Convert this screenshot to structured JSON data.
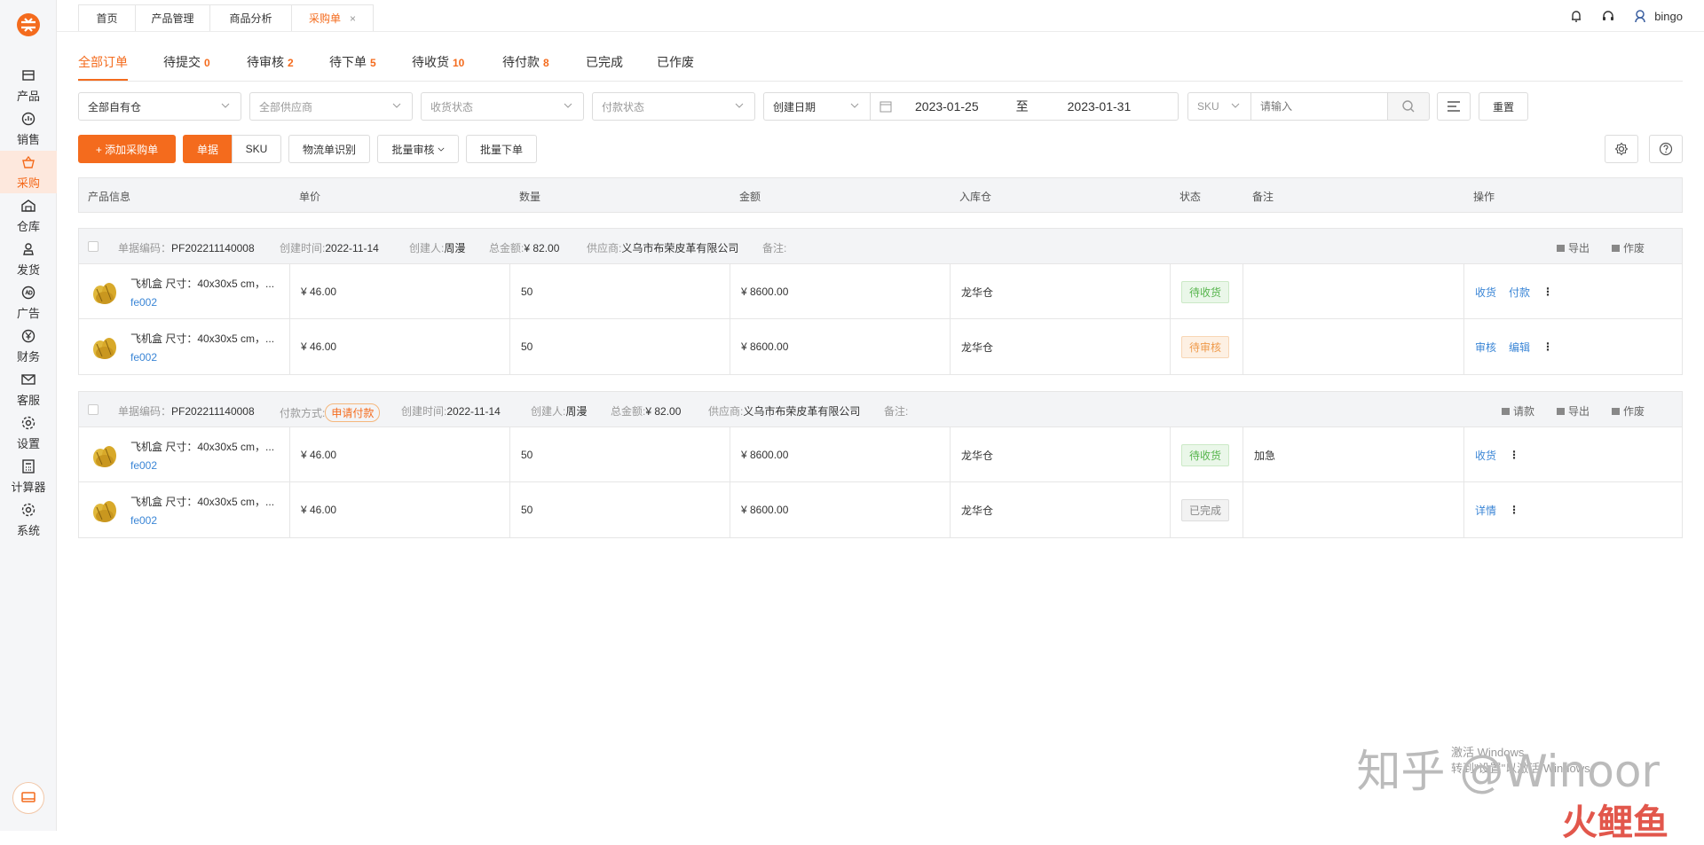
{
  "sidebar": {
    "items": [
      {
        "label": "产品",
        "icon": "box-icon"
      },
      {
        "label": "销售",
        "icon": "chart-icon"
      },
      {
        "label": "采购",
        "icon": "basket-icon",
        "active": true
      },
      {
        "label": "仓库",
        "icon": "warehouse-icon"
      },
      {
        "label": "发货",
        "icon": "truck-icon"
      },
      {
        "label": "广告",
        "icon": "ad-icon"
      },
      {
        "label": "财务",
        "icon": "yen-icon"
      },
      {
        "label": "客服",
        "icon": "mail-icon"
      },
      {
        "label": "设置",
        "icon": "gear-icon"
      },
      {
        "label": "计算器",
        "icon": "calculator-icon"
      },
      {
        "label": "系统",
        "icon": "gear-icon"
      }
    ]
  },
  "tabs": [
    {
      "label": "首页"
    },
    {
      "label": "产品管理"
    },
    {
      "label": "商品分析"
    },
    {
      "label": "采购单",
      "close": "×"
    }
  ],
  "user": {
    "name": "bingo"
  },
  "status_tabs": [
    {
      "label": "全部订单",
      "count": ""
    },
    {
      "label": "待提交",
      "count": "0"
    },
    {
      "label": "待审核",
      "count": "2"
    },
    {
      "label": "待下单",
      "count": "5"
    },
    {
      "label": "待收货",
      "count": "10"
    },
    {
      "label": "待付款",
      "count": "8"
    },
    {
      "label": "已完成",
      "count": ""
    },
    {
      "label": "已作废",
      "count": ""
    }
  ],
  "filters": {
    "warehouse": "全部自有仓",
    "supplier": "全部供应商",
    "receive_status": "收货状态",
    "pay_status": "付款状态",
    "date_type": "创建日期",
    "date_from": "2023-01-25",
    "date_sep": "至",
    "date_to": "2023-01-31",
    "search_type": "SKU",
    "search_placeholder": "请输入",
    "reset": "重置"
  },
  "toolbar": {
    "add": "+ 添加采购单",
    "view_order": "单据",
    "view_sku": "SKU",
    "logistics": "物流单识别",
    "batch_review": "批量审核",
    "batch_order": "批量下单"
  },
  "columns": [
    "产品信息",
    "单价",
    "数量",
    "金额",
    "入库仓",
    "状态",
    "备注",
    "操作"
  ],
  "orders": [
    {
      "code_label": "单据编码：",
      "code": "PF202211140008",
      "pay_label": "",
      "pay_value": "",
      "created_label": "创建时间:",
      "created": "2022-11-14",
      "creator_label": "创建人:",
      "creator": "周漫",
      "total_label": "总金额:",
      "total": "¥ 82.00",
      "supplier_label": "供应商:",
      "supplier": "义乌市布荣皮革有限公司",
      "note_label": "备注:",
      "actions": [
        "导出",
        "作废"
      ],
      "rows": [
        {
          "name": "飞机盒 尺寸：40x30x5 cm，...",
          "sku": "fe002",
          "price": "¥ 46.00",
          "qty": "50",
          "amount": "¥ 8600.00",
          "warehouse": "龙华仓",
          "status": "待收货",
          "status_type": "green",
          "note": "",
          "ops": [
            "收货",
            "付款"
          ]
        },
        {
          "name": "飞机盒 尺寸：40x30x5 cm，...",
          "sku": "fe002",
          "price": "¥ 46.00",
          "qty": "50",
          "amount": "¥ 8600.00",
          "warehouse": "龙华仓",
          "status": "待审核",
          "status_type": "orange",
          "note": "",
          "ops": [
            "审核",
            "编辑"
          ]
        }
      ]
    },
    {
      "code_label": "单据编码：",
      "code": "PF202211140008",
      "pay_label": "付款方式:",
      "pay_value": "申请付款",
      "created_label": "创建时间:",
      "created": "2022-11-14",
      "creator_label": "创建人:",
      "creator": "周漫",
      "total_label": "总金额:",
      "total": "¥ 82.00",
      "supplier_label": "供应商:",
      "supplier": "义乌市布荣皮革有限公司",
      "note_label": "备注:",
      "actions": [
        "请款",
        "导出",
        "作废"
      ],
      "rows": [
        {
          "name": "飞机盒 尺寸：40x30x5 cm，...",
          "sku": "fe002",
          "price": "¥ 46.00",
          "qty": "50",
          "amount": "¥ 8600.00",
          "warehouse": "龙华仓",
          "status": "待收货",
          "status_type": "green",
          "note": "加急",
          "ops": [
            "收货"
          ]
        },
        {
          "name": "飞机盒 尺寸：40x30x5 cm，...",
          "sku": "fe002",
          "price": "¥ 46.00",
          "qty": "50",
          "amount": "¥ 8600.00",
          "warehouse": "龙华仓",
          "status": "已完成",
          "status_type": "gray",
          "note": "",
          "ops": [
            "详情"
          ]
        }
      ]
    }
  ],
  "watermark": {
    "text": "知乎 @Winoor",
    "brand": "火鲤鱼",
    "activate1": "激活 Windows",
    "activate2": "转到\"设置\"以激活 Windows。"
  }
}
